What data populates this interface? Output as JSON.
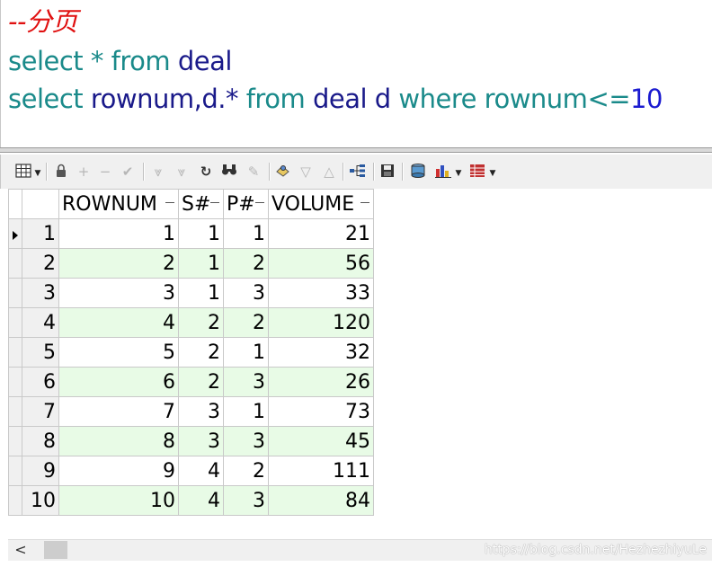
{
  "editor": {
    "comment": "--分页",
    "line2": {
      "kw1": "select",
      "op": "*",
      "kw2": "from",
      "table": "deal"
    },
    "line3": {
      "kw1": "select",
      "cols": "rownum,d.*",
      "kw2": "from",
      "table": "deal d",
      "kw3": "where",
      "cond_col": "rownum",
      "op": "<=",
      "value": "10"
    }
  },
  "toolbar": {
    "icons": [
      "grid-view-icon",
      "lock-icon",
      "add-record-icon",
      "delete-record-icon",
      "post-changes-icon",
      "fetch-next-icon",
      "fetch-last-icon",
      "refresh-icon",
      "find-icon",
      "clear-icon",
      "query-by-example-icon",
      "filter-icon",
      "sort-icon",
      "connect-icon",
      "save-icon",
      "export-icon",
      "chart-icon",
      "print-icon"
    ]
  },
  "grid": {
    "columns": [
      "ROWNUM",
      "S#",
      "P#",
      "VOLUME"
    ],
    "rows": [
      {
        "n": "1",
        "rownum": "1",
        "s": "1",
        "p": "1",
        "volume": "21"
      },
      {
        "n": "2",
        "rownum": "2",
        "s": "1",
        "p": "2",
        "volume": "56"
      },
      {
        "n": "3",
        "rownum": "3",
        "s": "1",
        "p": "3",
        "volume": "33"
      },
      {
        "n": "4",
        "rownum": "4",
        "s": "2",
        "p": "2",
        "volume": "120"
      },
      {
        "n": "5",
        "rownum": "5",
        "s": "2",
        "p": "1",
        "volume": "32"
      },
      {
        "n": "6",
        "rownum": "6",
        "s": "2",
        "p": "3",
        "volume": "26"
      },
      {
        "n": "7",
        "rownum": "7",
        "s": "3",
        "p": "1",
        "volume": "73"
      },
      {
        "n": "8",
        "rownum": "8",
        "s": "3",
        "p": "3",
        "volume": "45"
      },
      {
        "n": "9",
        "rownum": "9",
        "s": "4",
        "p": "2",
        "volume": "111"
      },
      {
        "n": "10",
        "rownum": "10",
        "s": "4",
        "p": "3",
        "volume": "84"
      }
    ],
    "colors": {
      "alt_row": "#e8fbe6",
      "indicator_bg": "#f0f0f0"
    }
  },
  "scrollbar": {
    "left_arrow": "<"
  },
  "watermark": "https://blog.csdn.net/HezhezhiyuLe"
}
